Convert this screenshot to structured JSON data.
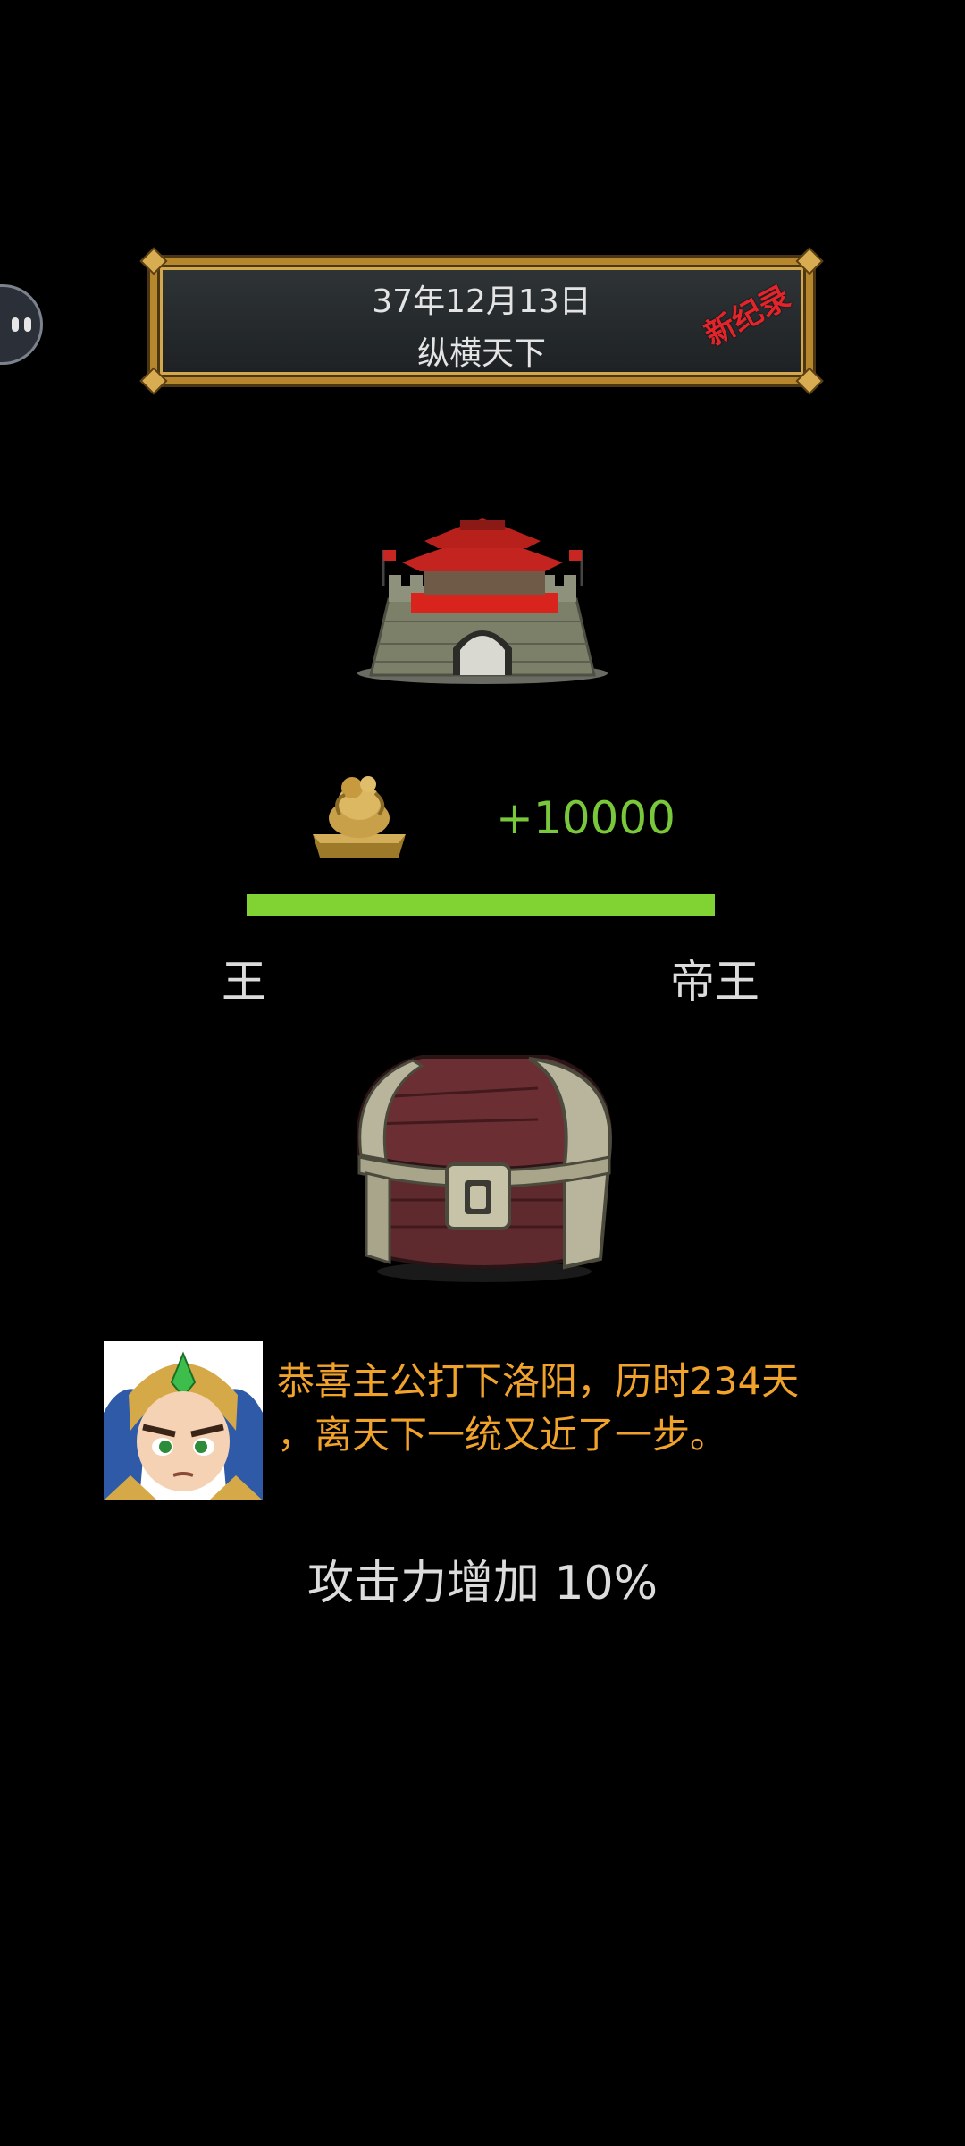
{
  "banner": {
    "date": "37年12月13日",
    "title": "纵横天下",
    "record_badge": "新纪录"
  },
  "reward": {
    "score": "+10000",
    "progress": 1.0
  },
  "rank": {
    "current": "王",
    "next": "帝王"
  },
  "advisor": {
    "message_line1": "恭喜主公打下洛阳，历时234天",
    "message_line2": "，离天下一统又近了一步。"
  },
  "bonus": {
    "text": "攻击力增加 10%"
  },
  "icons": {
    "float_ball": "assistant-ball-icon",
    "city": "city-gate-icon",
    "seal": "imperial-seal-icon",
    "chest": "treasure-chest-icon",
    "avatar": "general-portrait-icon"
  },
  "colors": {
    "score": "#79c73a",
    "progress": "#80d332",
    "message": "#f0a22b",
    "record": "#e3242b",
    "banner_border": "#b6872c"
  }
}
